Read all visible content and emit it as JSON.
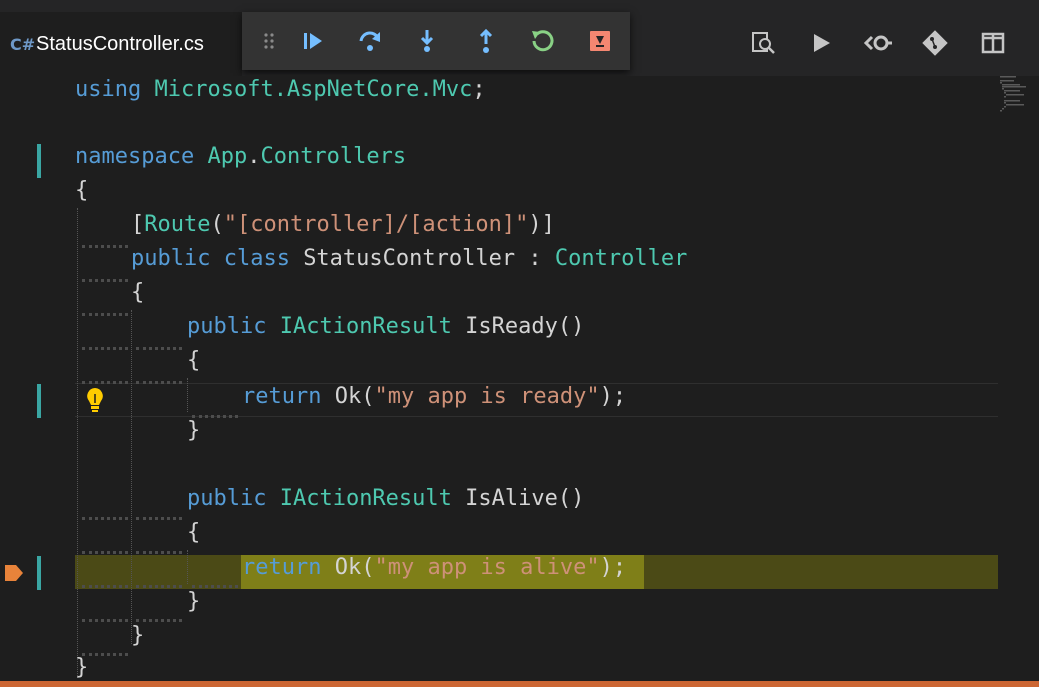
{
  "tab": {
    "icon": "C#",
    "filename": "StatusController.cs"
  },
  "debug_toolbar": {
    "items": [
      {
        "name": "drag-handle-icon"
      },
      {
        "name": "continue-icon"
      },
      {
        "name": "step-over-icon"
      },
      {
        "name": "step-into-icon"
      },
      {
        "name": "step-out-icon"
      },
      {
        "name": "restart-icon"
      },
      {
        "name": "stop-icon"
      }
    ]
  },
  "editor_actions": [
    {
      "name": "open-changes-icon"
    },
    {
      "name": "run-icon"
    },
    {
      "name": "inline-diff-icon"
    },
    {
      "name": "git-icon"
    },
    {
      "name": "split-editor-icon"
    }
  ],
  "colors": {
    "keyword": "#569cd6",
    "type": "#4ec9b0",
    "string": "#ce9178",
    "text": "#d4d4d4",
    "execution_highlight": "#7f7f18",
    "gutter_modified": "#3aa6a3",
    "breakpoint_arrow": "#e8833a",
    "status_bar": "#cc6633"
  },
  "code": {
    "l1": {
      "kw": "using ",
      "ns": "Microsoft.AspNetCore.Mvc",
      "semi": ";"
    },
    "l3": {
      "kw": "namespace ",
      "ns1": "App",
      "dot": ".",
      "ns2": "Controllers"
    },
    "l4": {
      "brace": "{"
    },
    "l5": {
      "open": "[",
      "attr": "Route",
      "paren": "(",
      "str": "\"[controller]/[action]\"",
      "close": ")]"
    },
    "l6": {
      "kw": "public class ",
      "name": "StatusController",
      "colon": " : ",
      "base": "Controller"
    },
    "l7": {
      "brace": "{"
    },
    "l8": {
      "kw": "public ",
      "type": "IActionResult",
      "method": " IsReady()"
    },
    "l9": {
      "brace": "{"
    },
    "l10": {
      "kw": "return ",
      "call": "Ok(",
      "str": "\"my app is ready\"",
      "end": ");"
    },
    "l11": {
      "brace": "}"
    },
    "l13": {
      "kw": "public ",
      "type": "IActionResult",
      "method": " IsAlive()"
    },
    "l14": {
      "brace": "{"
    },
    "l15": {
      "kw": "return ",
      "call": "Ok(",
      "str": "\"my app is alive\"",
      "end": ");"
    },
    "l16": {
      "brace": "}"
    },
    "l17": {
      "brace": "}"
    },
    "l18": {
      "brace": "}"
    }
  }
}
